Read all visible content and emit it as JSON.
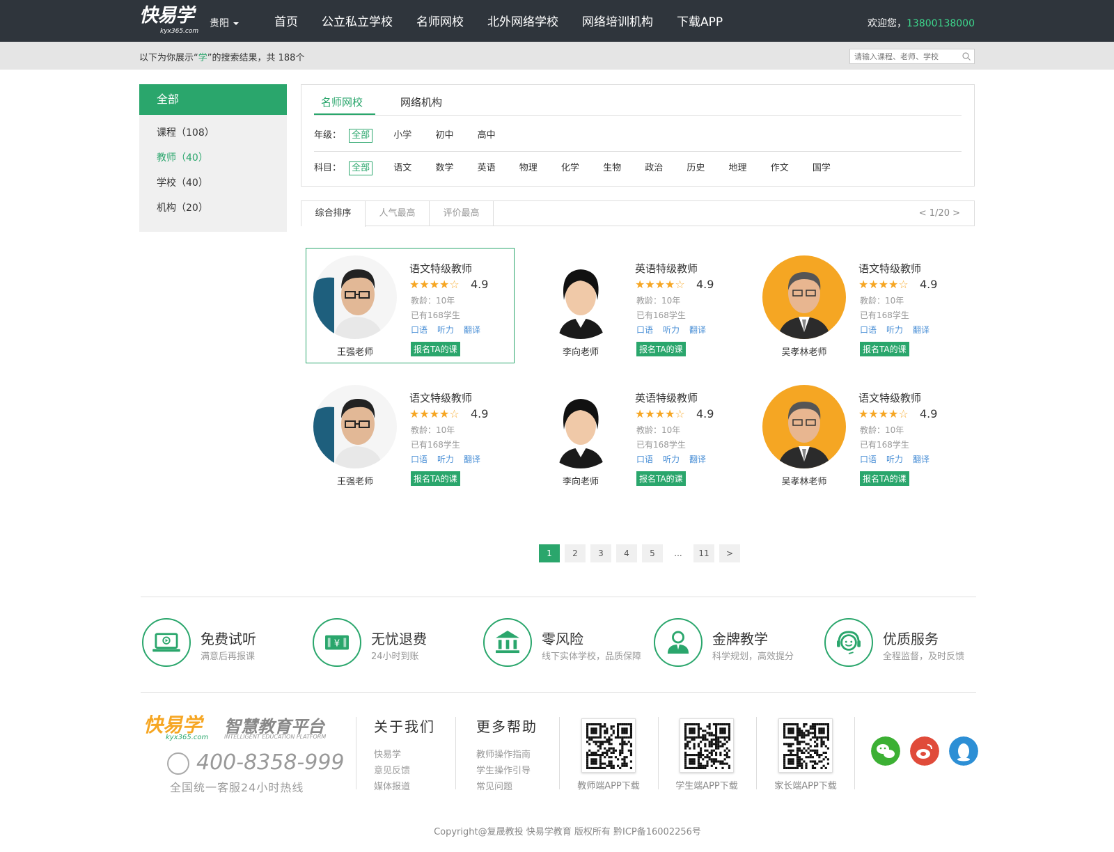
{
  "header": {
    "logo_text": "快易学",
    "logo_sub": "kyx365.com",
    "city": "贵阳",
    "nav": [
      "首页",
      "公立私立学校",
      "名师网校",
      "北外网络学校",
      "网络培训机构",
      "下载APP"
    ],
    "welcome": "欢迎您，",
    "phone": "13800138000"
  },
  "searchbar": {
    "prefix": "以下为你展示“",
    "keyword": "学",
    "suffix": "”的搜索结果，共 188个",
    "placeholder": "请输入课程、老师、学校"
  },
  "sidebar": {
    "all": "全部",
    "items": [
      "课程（108）",
      "教师（40）",
      "学校（40）",
      "机构（20）"
    ]
  },
  "filter": {
    "tabs": [
      "名师网校",
      "网络机构"
    ],
    "grade_label": "年级：",
    "grades": [
      "全部",
      "小学",
      "初中",
      "高中"
    ],
    "subject_label": "科目：",
    "subjects": [
      "全部",
      "语文",
      "数学",
      "英语",
      "物理",
      "化学",
      "生物",
      "政治",
      "历史",
      "地理",
      "作文",
      "国学"
    ]
  },
  "sort": {
    "options": [
      "综合排序",
      "人气最高",
      "评价最高"
    ],
    "page_info": "< 1/20 >"
  },
  "teachers": [
    {
      "name": "王强老师",
      "title": "语文特级教师",
      "stars": 4,
      "rating": "4.9",
      "years": "教龄：10年",
      "students": "已有168学生",
      "tags": [
        "口语",
        "听力",
        "翻译"
      ],
      "button": "报名TA的课"
    },
    {
      "name": "李向老师",
      "title": "英语特级教师",
      "stars": 4,
      "rating": "4.9",
      "years": "教龄：10年",
      "students": "已有168学生",
      "tags": [
        "口语",
        "听力",
        "翻译"
      ],
      "button": "报名TA的课"
    },
    {
      "name": "吴孝林老师",
      "title": "语文特级教师",
      "stars": 4,
      "rating": "4.9",
      "years": "教龄：10年",
      "students": "已有168学生",
      "tags": [
        "口语",
        "听力",
        "翻译"
      ],
      "button": "报名TA的课"
    },
    {
      "name": "王强老师",
      "title": "语文特级教师",
      "stars": 4,
      "rating": "4.9",
      "years": "教龄：10年",
      "students": "已有168学生",
      "tags": [
        "口语",
        "听力",
        "翻译"
      ],
      "button": "报名TA的课"
    },
    {
      "name": "李向老师",
      "title": "英语特级教师",
      "stars": 4,
      "rating": "4.9",
      "years": "教龄：10年",
      "students": "已有168学生",
      "tags": [
        "口语",
        "听力",
        "翻译"
      ],
      "button": "报名TA的课"
    },
    {
      "name": "吴孝林老师",
      "title": "语文特级教师",
      "stars": 4,
      "rating": "4.9",
      "years": "教龄：10年",
      "students": "已有168学生",
      "tags": [
        "口语",
        "听力",
        "翻译"
      ],
      "button": "报名TA的课"
    }
  ],
  "pagination": [
    "1",
    "2",
    "3",
    "4",
    "5",
    "...",
    "11",
    ">"
  ],
  "features": [
    {
      "title": "免费试听",
      "sub": "满意后再报课",
      "icon": "laptop-play-icon"
    },
    {
      "title": "无忧退费",
      "sub": "24小时到账",
      "icon": "money-ticket-icon"
    },
    {
      "title": "零风险",
      "sub": "线下实体学校，品质保障",
      "icon": "bank-building-icon"
    },
    {
      "title": "金牌教学",
      "sub": "科学规划，高效提分",
      "icon": "teacher-icon"
    },
    {
      "title": "优质服务",
      "sub": "全程监督，及时反馈",
      "icon": "headset-service-icon"
    }
  ],
  "footer": {
    "brand": "快易学",
    "url": "kyx365.com",
    "slogan": "智慧教育平台",
    "slogan_en": "INTELLIGENT EDUCATION PLATFORM",
    "hotline": "400-8358-999",
    "hotline_sub": "全国统一客服24小时热线",
    "about_title": "关于我们",
    "about_links": [
      "快易学",
      "意见反馈",
      "媒体报道"
    ],
    "help_title": "更多帮助",
    "help_links": [
      "教师操作指南",
      "学生操作引导",
      "常见问题"
    ],
    "qrcodes": [
      "教师端APP下载",
      "学生端APP下载",
      "家长端APP下载"
    ],
    "copyright": "Copyright@复晟教投  快易学教育  版权所有  黔ICP备16002256号"
  },
  "colors": {
    "brand_green": "#2aa66c",
    "header_dark": "#2f353c",
    "star_orange": "#f6a623",
    "link_blue": "#4a8fd6"
  }
}
